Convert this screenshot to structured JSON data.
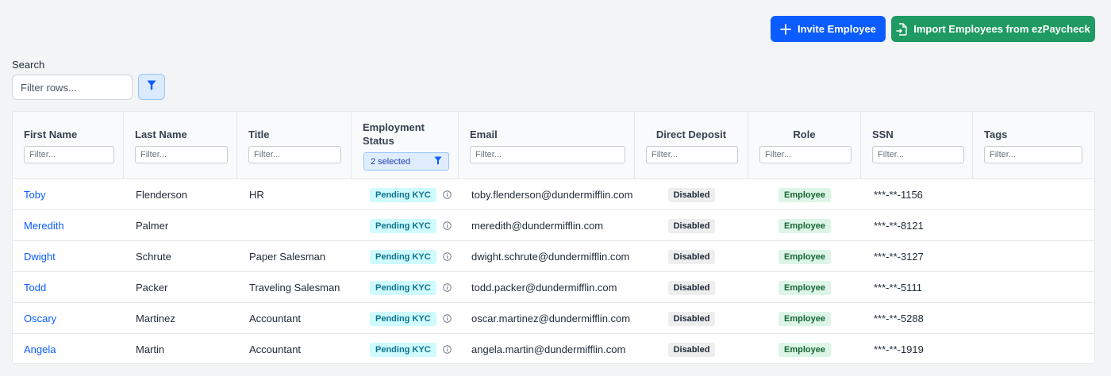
{
  "actions": {
    "invite_label": "Invite Employee",
    "import_label": "Import Employees from ezPaycheck"
  },
  "search": {
    "label": "Search",
    "placeholder": "Filter rows..."
  },
  "columns": {
    "first_name": "First Name",
    "last_name": "Last Name",
    "title": "Title",
    "status": "Employment Status",
    "email": "Email",
    "deposit": "Direct Deposit",
    "role": "Role",
    "ssn": "SSN",
    "tags": "Tags"
  },
  "filter_placeholder": "Filter...",
  "status_filter_value": "2 selected",
  "rows": [
    {
      "first": "Toby",
      "last": "Flenderson",
      "title": "HR",
      "status": "Pending KYC",
      "email": "toby.flenderson@dundermifflin.com",
      "deposit": "Disabled",
      "role": "Employee",
      "ssn": "***-**-1156",
      "tags": ""
    },
    {
      "first": "Meredith",
      "last": "Palmer",
      "title": "",
      "status": "Pending KYC",
      "email": "meredith@dundermifflin.com",
      "deposit": "Disabled",
      "role": "Employee",
      "ssn": "***-**-8121",
      "tags": ""
    },
    {
      "first": "Dwight",
      "last": "Schrute",
      "title": "Paper Salesman",
      "status": "Pending KYC",
      "email": "dwight.schrute@dundermifflin.com",
      "deposit": "Disabled",
      "role": "Employee",
      "ssn": "***-**-3127",
      "tags": ""
    },
    {
      "first": "Todd",
      "last": "Packer",
      "title": "Traveling Salesman",
      "status": "Pending KYC",
      "email": "todd.packer@dundermifflin.com",
      "deposit": "Disabled",
      "role": "Employee",
      "ssn": "***-**-5111",
      "tags": ""
    },
    {
      "first": "Oscary",
      "last": "Martinez",
      "title": "Accountant",
      "status": "Pending KYC",
      "email": "oscar.martinez@dundermifflin.com",
      "deposit": "Disabled",
      "role": "Employee",
      "ssn": "***-**-5288",
      "tags": ""
    },
    {
      "first": "Angela",
      "last": "Martin",
      "title": "Accountant",
      "status": "Pending KYC",
      "email": "angela.martin@dundermifflin.com",
      "deposit": "Disabled",
      "role": "Employee",
      "ssn": "***-**-1919",
      "tags": ""
    }
  ],
  "icons": {
    "invite": "plus-icon",
    "import": "file-import-icon",
    "filter": "funnel-icon",
    "status_info": "info-circle-icon"
  },
  "colors": {
    "primary": "#0b5cff",
    "success": "#1f9a63",
    "link": "#0b5cff",
    "kyc_badge_bg": "#cffafe",
    "employee_badge_bg": "#dcf5e7"
  }
}
